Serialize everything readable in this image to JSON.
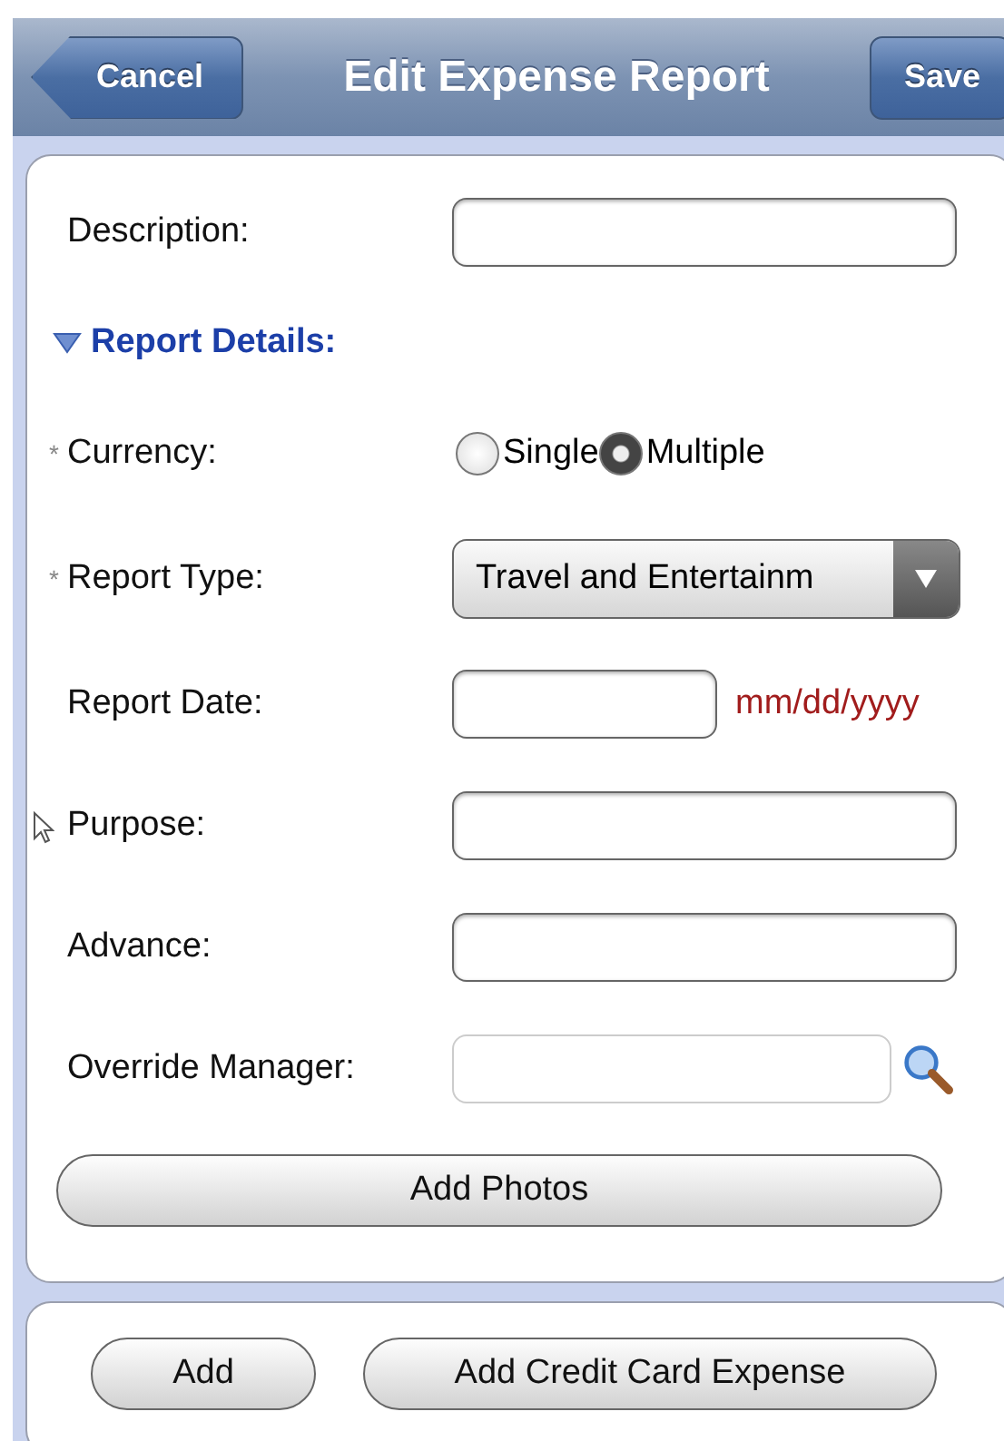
{
  "nav_bar": {
    "title": "Edit Expense Report",
    "back_button": "Cancel",
    "action_button": "Save"
  },
  "form": [
    {
      "kind": "text",
      "label": "Description:"
    },
    {
      "kind": "section",
      "label": "Report Details:",
      "expanded": true
    },
    {
      "kind": "radio",
      "label": "Currency:",
      "required_mark": "*",
      "options": [
        {
          "label": "Single",
          "selected": false
        },
        {
          "label": "Multiple",
          "selected": true
        }
      ]
    },
    {
      "kind": "select",
      "label": "Report Type:",
      "required_mark": "*",
      "value": "Travel and Entertainm"
    },
    {
      "kind": "date",
      "label": "Report Date:",
      "hint": "mm/dd/yyyy"
    },
    {
      "kind": "text",
      "label": "Purpose:"
    },
    {
      "kind": "text",
      "label": "Advance:"
    },
    {
      "kind": "lookup",
      "label": "Override Manager:"
    },
    {
      "kind": "button",
      "label": "Add Photos"
    }
  ],
  "footer_buttons": [
    "Add",
    "Add Credit Card Expense"
  ]
}
